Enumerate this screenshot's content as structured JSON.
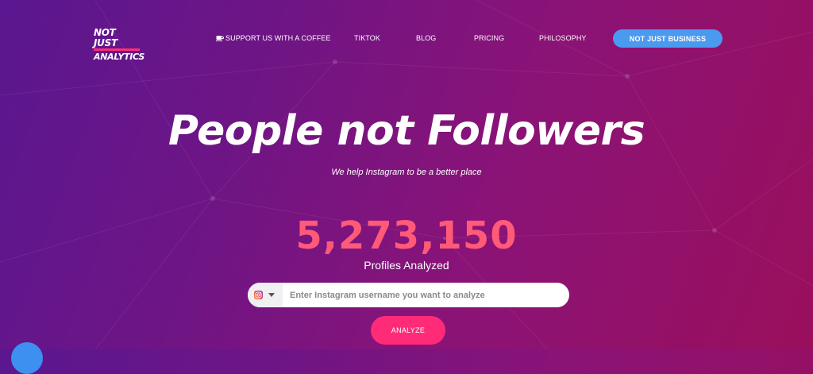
{
  "header": {
    "logo_line1": "NOT JUST",
    "logo_line2": "ANALYTICS",
    "nav": [
      {
        "label": "SUPPORT US WITH A COFFEE",
        "icon": "coffee-icon"
      },
      {
        "label": "TIKTOK"
      },
      {
        "label": "BLOG"
      },
      {
        "label": "PRICING"
      },
      {
        "label": "PHILOSOPHY"
      }
    ],
    "cta_label": "NOT JUST BUSINESS"
  },
  "hero": {
    "title": "People not Followers",
    "subtitle": "We help Instagram to be a better place",
    "counter": "5,273,150",
    "counter_label": "Profiles Analyzed"
  },
  "search": {
    "platform_icon": "instagram-icon",
    "placeholder": "Enter Instagram username you want to analyze",
    "value": ""
  },
  "analyze_label": "ANALYZE",
  "colors": {
    "accent_pink": "#ff2b78",
    "counter_pink": "#ff5a78",
    "cta_blue": "#4a9af0",
    "bg_start": "#5a1790",
    "bg_end": "#9a0f5c"
  }
}
